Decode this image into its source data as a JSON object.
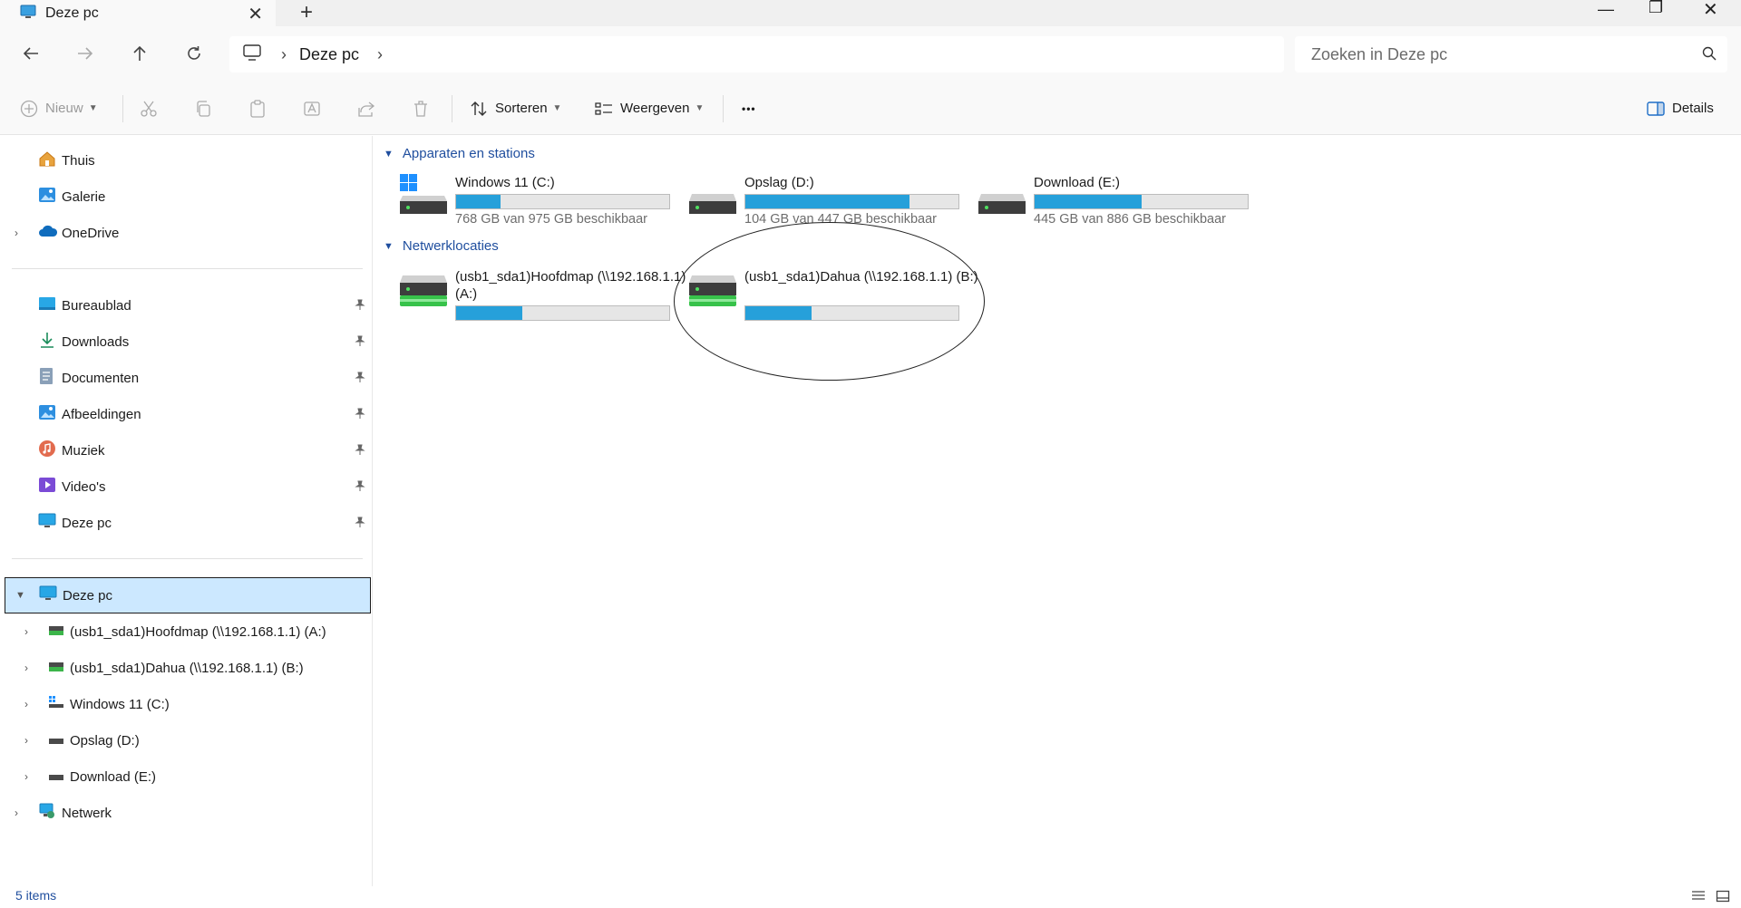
{
  "window": {
    "tab_title": "Deze pc",
    "close_tab": "✕",
    "new_tab": "+",
    "minimize": "—",
    "restore": "❐",
    "close": "✕"
  },
  "address": {
    "crumb": "Deze pc",
    "separator": "›",
    "search_placeholder": "Zoeken in Deze pc"
  },
  "commandbar": {
    "new_label": "Nieuw",
    "sort_label": "Sorteren",
    "view_label": "Weergeven",
    "more_label": "•••",
    "details_label": "Details"
  },
  "sidebar": {
    "top": [
      {
        "label": "Thuis",
        "icon": "home-icon"
      },
      {
        "label": "Galerie",
        "icon": "gallery-icon"
      },
      {
        "label": "OneDrive",
        "icon": "cloud-icon"
      }
    ],
    "pinned": [
      {
        "label": "Bureaublad",
        "icon": "desktop-icon"
      },
      {
        "label": "Downloads",
        "icon": "download-icon"
      },
      {
        "label": "Documenten",
        "icon": "document-icon"
      },
      {
        "label": "Afbeeldingen",
        "icon": "pictures-icon"
      },
      {
        "label": "Muziek",
        "icon": "music-icon"
      },
      {
        "label": "Video's",
        "icon": "video-icon"
      },
      {
        "label": "Deze pc",
        "icon": "pc-icon"
      }
    ],
    "tree": {
      "root": "Deze pc",
      "children": [
        "(usb1_sda1)Hoofdmap (\\\\192.168.1.1) (A:)",
        "(usb1_sda1)Dahua (\\\\192.168.1.1) (B:)",
        "Windows 11 (C:)",
        "Opslag (D:)",
        "Download (E:)"
      ],
      "network": "Netwerk"
    }
  },
  "content": {
    "group_devices": "Apparaten en stations",
    "group_network": "Netwerklocaties",
    "drives": [
      {
        "name": "Windows 11 (C:)",
        "free": "768 GB van 975 GB beschikbaar",
        "used_fraction": 0.21,
        "icon": "windows-drive-icon"
      },
      {
        "name": "Opslag (D:)",
        "free": "104 GB van 447 GB beschikbaar",
        "used_fraction": 0.77,
        "icon": "hard-drive-icon"
      },
      {
        "name": "Download (E:)",
        "free": "445 GB van 886 GB beschikbaar",
        "used_fraction": 0.5,
        "icon": "hard-drive-icon"
      }
    ],
    "network_drives": [
      {
        "name": "(usb1_sda1)Hoofdmap (\\\\192.168.1.1) (A:)",
        "used_fraction": 0.31,
        "icon": "network-drive-icon"
      },
      {
        "name": "(usb1_sda1)Dahua (\\\\192.168.1.1) (B:)",
        "used_fraction": 0.31,
        "icon": "network-drive-icon"
      }
    ]
  },
  "status": {
    "count": "5 items"
  },
  "colors": {
    "accent": "#26a0da",
    "selection": "#cce8ff",
    "link": "#1f4e9e"
  }
}
